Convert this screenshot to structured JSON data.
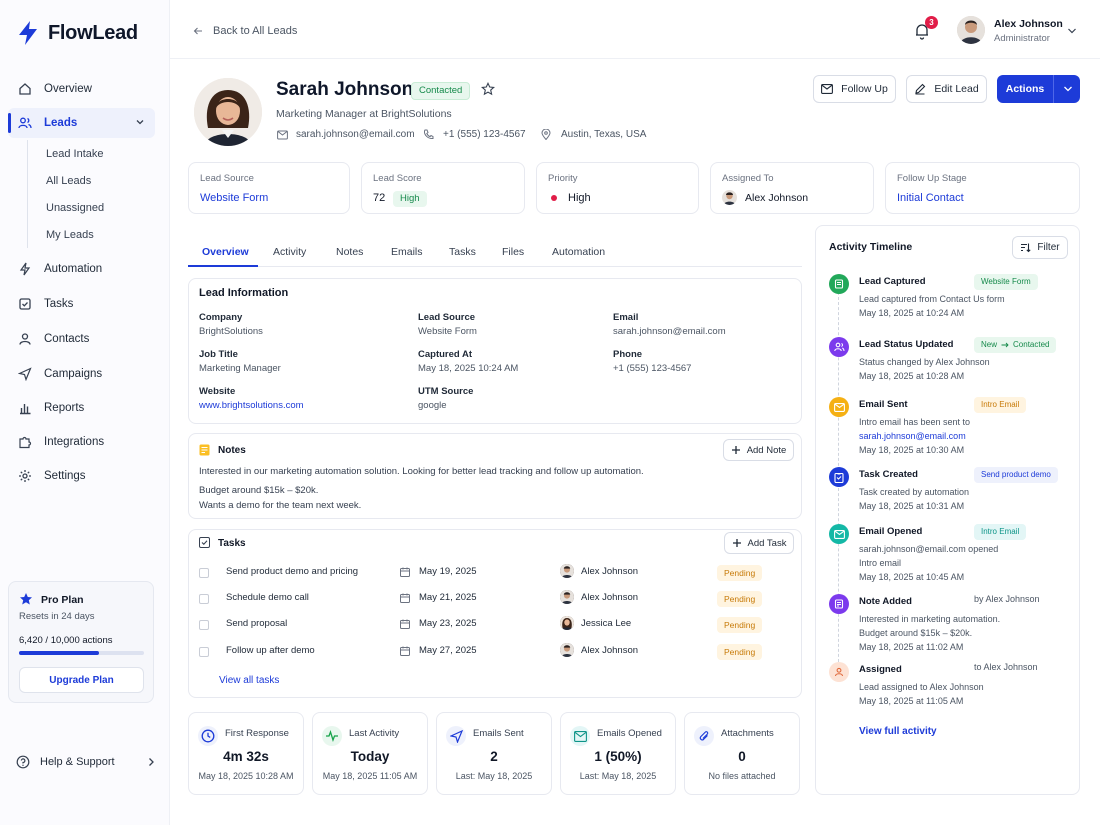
{
  "app": {
    "name": "FlowLead"
  },
  "nav": {
    "items": [
      {
        "label": "Overview"
      },
      {
        "label": "Leads"
      },
      {
        "label": "Automation"
      },
      {
        "label": "Tasks"
      },
      {
        "label": "Contacts"
      },
      {
        "label": "Campaigns"
      },
      {
        "label": "Reports"
      },
      {
        "label": "Integrations"
      },
      {
        "label": "Settings"
      }
    ],
    "sub_items": [
      {
        "label": "Lead Intake"
      },
      {
        "label": "All Leads"
      },
      {
        "label": "Unassigned"
      },
      {
        "label": "My Leads"
      }
    ]
  },
  "plan": {
    "title": "Pro Plan",
    "resets": "Resets in 24 days",
    "usage": "6,420 / 10,000 actions",
    "usage_fraction": 0.642,
    "upgrade_label": "Upgrade Plan"
  },
  "help_label": "Help & Support",
  "topbar": {
    "back_label": "Back to All Leads",
    "notification_count": "3",
    "user_name": "Alex Johnson",
    "user_role": "Administrator"
  },
  "lead": {
    "name": "Sarah Johnson",
    "status": "Contacted",
    "title": "Marketing Manager at BrightSolutions",
    "email": "sarah.johnson@email.com",
    "phone": "+1 (555) 123-4567",
    "location": "Austin, Texas, USA"
  },
  "actions": {
    "follow_up": "Follow Up",
    "edit_lead": "Edit Lead",
    "actions": "Actions"
  },
  "summary": {
    "lead_source": {
      "label": "Lead Source",
      "value": "Website Form"
    },
    "lead_score": {
      "label": "Lead Score",
      "value": "72",
      "badge": "High"
    },
    "priority": {
      "label": "Priority",
      "value": "High"
    },
    "assigned_to": {
      "label": "Assigned To",
      "value": "Alex Johnson"
    },
    "stage": {
      "label": "Follow Up Stage",
      "value": "Initial Contact"
    }
  },
  "tabs": [
    {
      "label": "Overview"
    },
    {
      "label": "Activity"
    },
    {
      "label": "Notes"
    },
    {
      "label": "Emails"
    },
    {
      "label": "Tasks"
    },
    {
      "label": "Files"
    },
    {
      "label": "Automation"
    }
  ],
  "lead_info": {
    "title": "Lead Information",
    "company": {
      "label": "Company",
      "value": "BrightSolutions"
    },
    "lead_source": {
      "label": "Lead Source",
      "value": "Website Form"
    },
    "email": {
      "label": "Email",
      "value": "sarah.johnson@email.com"
    },
    "job_title": {
      "label": "Job Title",
      "value": "Marketing Manager"
    },
    "captured_at": {
      "label": "Captured At",
      "value": "May 18, 2025 10:24 AM"
    },
    "phone": {
      "label": "Phone",
      "value": "+1 (555) 123-4567"
    },
    "website": {
      "label": "Website",
      "value": "www.brightsolutions.com"
    },
    "utm_source": {
      "label": "UTM Source",
      "value": "google"
    }
  },
  "notes": {
    "title": "Notes",
    "add_label": "Add Note",
    "lines": [
      "Interested in our marketing automation solution. Looking for better lead tracking and follow up automation.",
      "Budget around $15k – $20k.",
      "Wants a demo for the team next week."
    ]
  },
  "tasks": {
    "title": "Tasks",
    "add_label": "Add Task",
    "view_all": "View all tasks",
    "rows": [
      {
        "name": "Send product demo and pricing",
        "date": "May 19, 2025",
        "assignee": "Alex Johnson",
        "status": "Pending"
      },
      {
        "name": "Schedule demo call",
        "date": "May 21, 2025",
        "assignee": "Alex Johnson",
        "status": "Pending"
      },
      {
        "name": "Send proposal",
        "date": "May 23, 2025",
        "assignee": "Jessica Lee",
        "status": "Pending"
      },
      {
        "name": "Follow up after demo",
        "date": "May 27, 2025",
        "assignee": "Alex Johnson",
        "status": "Pending"
      }
    ]
  },
  "stats": [
    {
      "title": "First Response",
      "value": "4m 32s",
      "sub": "May 18, 2025 10:28 AM",
      "icon": "clock-icon"
    },
    {
      "title": "Last Activity",
      "value": "Today",
      "sub": "May 18, 2025 11:05 AM",
      "icon": "activity-icon"
    },
    {
      "title": "Emails Sent",
      "value": "2",
      "sub": "Last: May 18, 2025",
      "icon": "send-icon"
    },
    {
      "title": "Emails Opened",
      "value": "1 (50%)",
      "sub": "Last: May 18, 2025",
      "icon": "mail-icon"
    },
    {
      "title": "Attachments",
      "value": "0",
      "sub": "No files attached",
      "icon": "paperclip-icon"
    }
  ],
  "timeline": {
    "title": "Activity Timeline",
    "filter_label": "Filter",
    "view_full": "View full activity",
    "items": [
      {
        "title": "Lead Captured",
        "tag": "Website Form",
        "desc1": "Lead captured from Contact Us form",
        "desc2": "",
        "time": "May 18, 2025 at 10:24 AM"
      },
      {
        "title": "Lead Status Updated",
        "tag_from": "New",
        "tag_to": "Contacted",
        "desc1": "Status changed by Alex Johnson",
        "desc2": "",
        "time": "May 18, 2025 at 10:28 AM"
      },
      {
        "title": "Email Sent",
        "tag": "Intro Email",
        "desc1": "Intro email has been sent to",
        "desc2": "sarah.johnson@email.com",
        "time": "May 18, 2025 at 10:30 AM"
      },
      {
        "title": "Task Created",
        "tag": "Send product demo",
        "desc1": "Task created by automation",
        "desc2": "",
        "time": "May 18, 2025 at 10:31 AM"
      },
      {
        "title": "Email Opened",
        "tag": "Intro Email",
        "desc1": "sarah.johnson@email.com opened",
        "desc2": "Intro email",
        "time": "May 18, 2025 at 10:45 AM"
      },
      {
        "title": "Note Added",
        "by": "by Alex Johnson",
        "desc1": "Interested in marketing automation.",
        "desc2": "Budget around $15k – $20k.",
        "time": "May 18, 2025 at 11:02 AM"
      },
      {
        "title": "Assigned",
        "by": "to Alex Johnson",
        "desc1": "Lead assigned to Alex Johnson",
        "desc2": "",
        "time": "May 18, 2025 at 11:05 AM"
      }
    ]
  }
}
